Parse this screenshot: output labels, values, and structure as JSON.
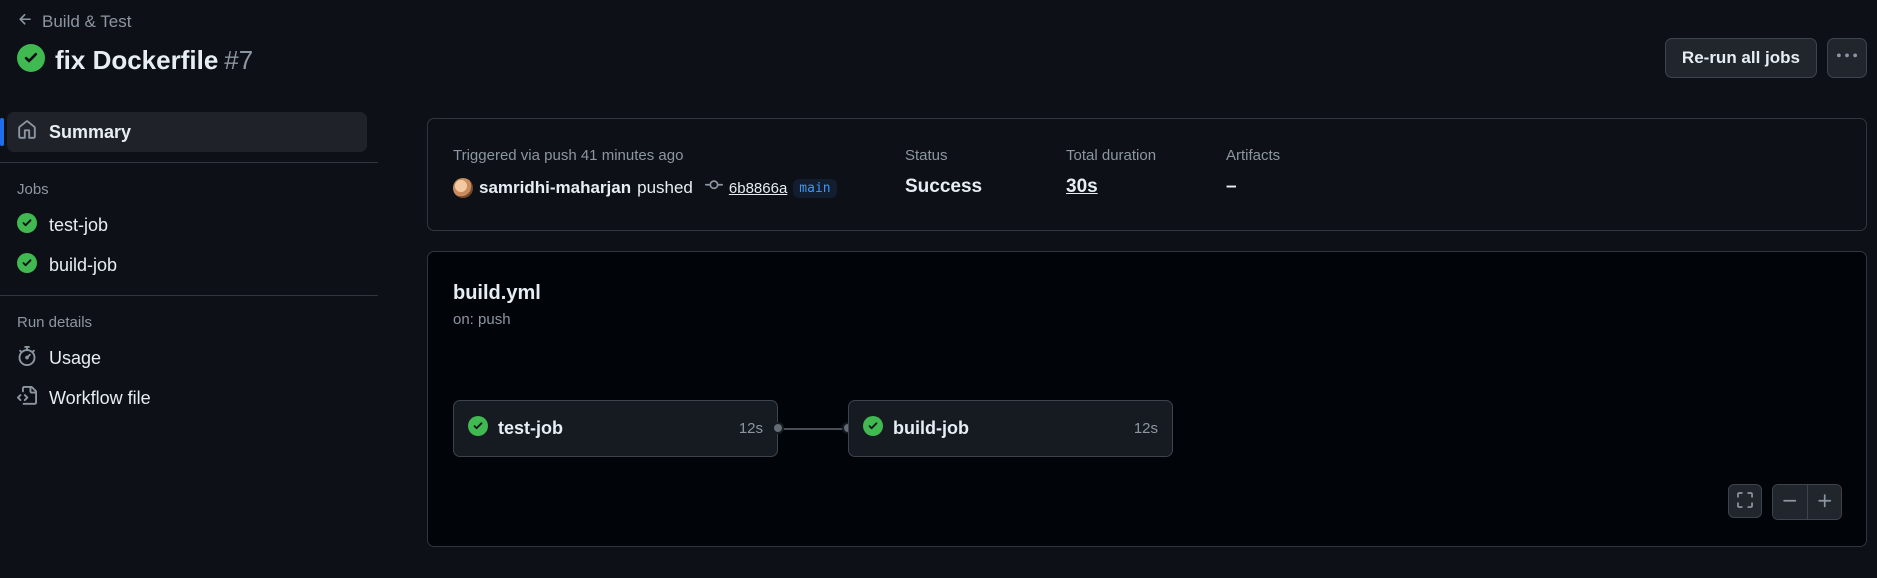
{
  "breadcrumb": {
    "back_label": "Build & Test"
  },
  "run": {
    "title": "fix Dockerfile",
    "number": "#7"
  },
  "actions": {
    "rerun_label": "Re-run all jobs"
  },
  "sidebar": {
    "summary_label": "Summary",
    "jobs_heading": "Jobs",
    "jobs": [
      {
        "label": "test-job",
        "status": "success"
      },
      {
        "label": "build-job",
        "status": "success"
      }
    ],
    "run_details_heading": "Run details",
    "details": [
      {
        "label": "Usage",
        "icon": "stopwatch-icon"
      },
      {
        "label": "Workflow file",
        "icon": "file-code-icon"
      }
    ]
  },
  "summary": {
    "trigger_text": "Triggered via push 41 minutes ago",
    "actor": "samridhi-maharjan",
    "verb": "pushed",
    "commit_sha": "6b8866a",
    "branch": "main",
    "status_label": "Status",
    "status_value": "Success",
    "duration_label": "Total duration",
    "duration_value": "30s",
    "artifacts_label": "Artifacts",
    "artifacts_value": "–"
  },
  "workflow": {
    "file_name": "build.yml",
    "trigger": "on: push",
    "jobs": [
      {
        "name": "test-job",
        "time": "12s",
        "status": "success"
      },
      {
        "name": "build-job",
        "time": "12s",
        "status": "success"
      }
    ]
  },
  "colors": {
    "success": "#3fb950",
    "accent": "#1f6feb",
    "background": "#0d1117"
  }
}
